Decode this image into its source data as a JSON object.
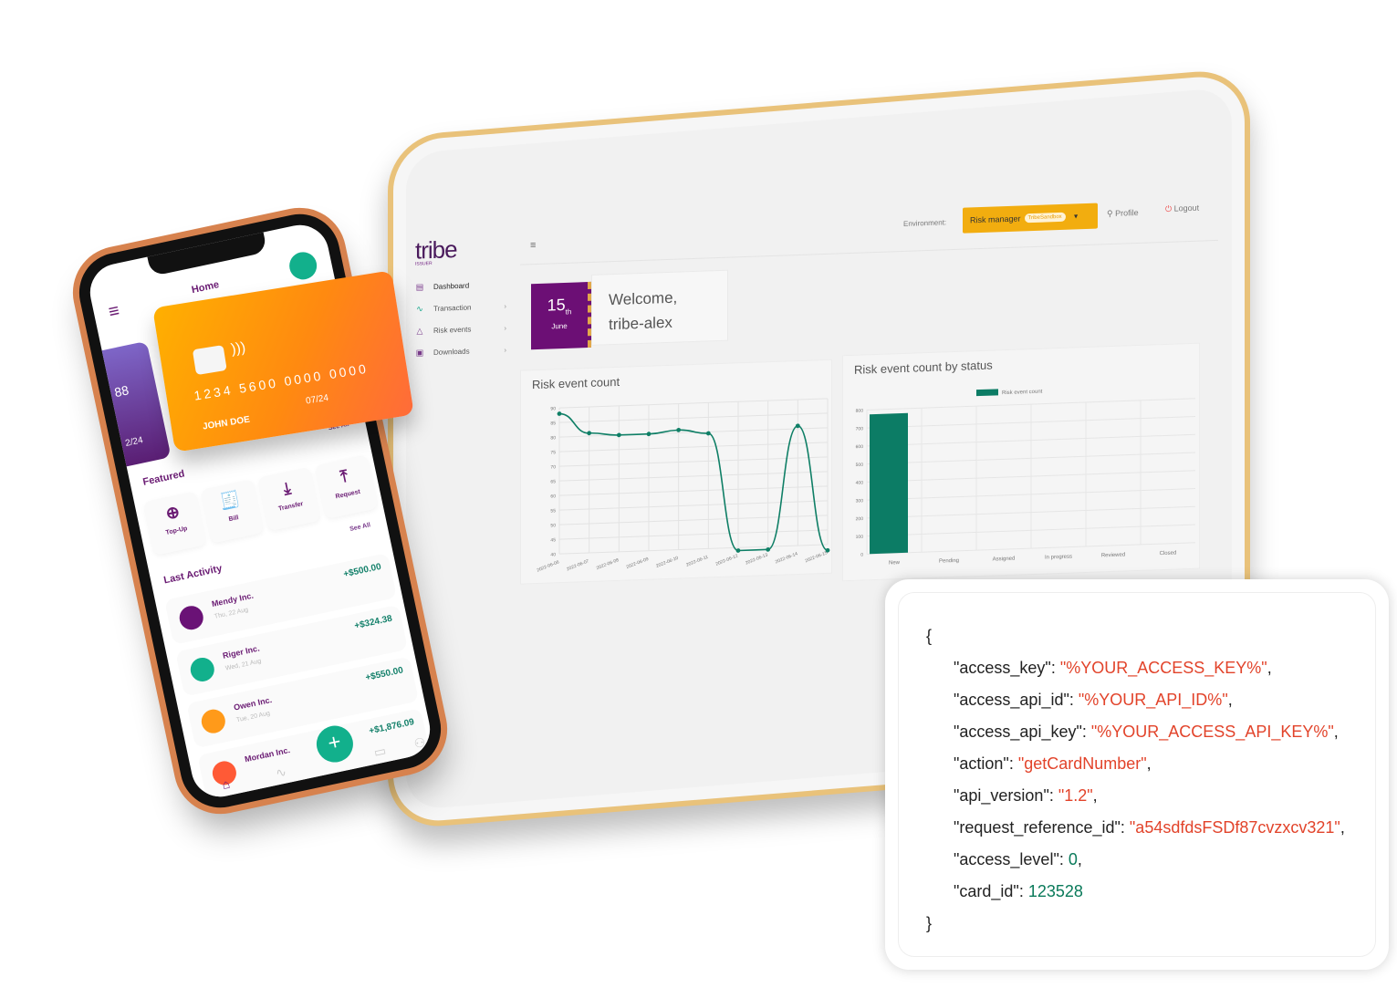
{
  "tablet": {
    "logo": "tribe",
    "logo_sub": "ISSUER",
    "sidebar": [
      {
        "label": "Dashboard",
        "icon": "calendar-icon",
        "active": true
      },
      {
        "label": "Transaction",
        "icon": "pulse-icon"
      },
      {
        "label": "Risk events",
        "icon": "warning-icon"
      },
      {
        "label": "Downloads",
        "icon": "save-icon"
      }
    ],
    "header": {
      "environment_label": "Environment:",
      "role": "Risk manager",
      "env_badge": "TribeSandbox",
      "profile": "Profile",
      "logout": "Logout"
    },
    "date": {
      "day": "15",
      "suffix": "th",
      "month": "June"
    },
    "welcome": {
      "line1": "Welcome,",
      "line2": "tribe-alex"
    }
  },
  "chart_data": [
    {
      "type": "line",
      "title": "Risk event count",
      "categories": [
        "2022-06-06",
        "2022-06-07",
        "2022-06-08",
        "2022-06-09",
        "2022-06-10",
        "2022-06-11",
        "2022-06-12",
        "2022-06-13",
        "2022-06-14",
        "2022-06-15"
      ],
      "values": [
        88,
        81,
        80,
        80,
        81,
        79.5,
        39,
        39,
        81,
        38
      ],
      "ylim": [
        40,
        90
      ],
      "yticks": [
        40,
        45,
        50,
        55,
        60,
        65,
        70,
        75,
        80,
        85,
        90
      ],
      "grid": true,
      "color": "#0f7f66"
    },
    {
      "type": "bar",
      "title": "Risk event count by status",
      "categories": [
        "New",
        "Pending",
        "Assigned",
        "In progress",
        "Reviewed",
        "Closed"
      ],
      "series": [
        {
          "name": "Risk event count",
          "values": [
            775,
            0,
            0,
            0,
            0,
            0
          ]
        }
      ],
      "ylim": [
        0,
        800
      ],
      "yticks": [
        0,
        100,
        200,
        300,
        400,
        500,
        600,
        700,
        800
      ],
      "legend": "top",
      "grid": true,
      "color": "#0c7c65"
    }
  ],
  "phone": {
    "title": "Home",
    "card_number": "1234 5600 0000 0000",
    "card_holder": "JOHN DOE",
    "card_expiry": "07/24",
    "back_card_digits": "88",
    "back_card_expiry": "2/24",
    "featured_label": "Featured",
    "see_all": "See All",
    "featured": [
      {
        "label": "Top-Up",
        "icon": "plus-circle-icon"
      },
      {
        "label": "Bill",
        "icon": "bill-icon"
      },
      {
        "label": "Transfer",
        "icon": "download-icon"
      },
      {
        "label": "Request",
        "icon": "upload-icon"
      }
    ],
    "last_activity_label": "Last Activity",
    "activity": [
      {
        "name": "Mendy Inc.",
        "date": "Thu, 22 Aug",
        "amount": "+$500.00",
        "color": "#6a1276"
      },
      {
        "name": "Riger Inc.",
        "date": "Wed, 21 Aug",
        "amount": "+$324.38",
        "color": "#12b08c"
      },
      {
        "name": "Owen Inc.",
        "date": "Tue, 20 Aug",
        "amount": "+$550.00",
        "color": "#ff9a1a"
      },
      {
        "name": "Mordan Inc.",
        "date": "",
        "amount": "+$1,876.09",
        "color": "#ff5a36"
      }
    ]
  },
  "json_sample": {
    "open": "{",
    "close": "}",
    "lines": [
      {
        "key": "\"access_key\"",
        "value": "\"%YOUR_ACCESS_KEY%\"",
        "kind": "str"
      },
      {
        "key": "\"access_api_id\"",
        "value": "\"%YOUR_API_ID%\"",
        "kind": "str"
      },
      {
        "key": "\"access_api_key\"",
        "value": "\"%YOUR_ACCESS_API_KEY%\"",
        "kind": "str"
      },
      {
        "key": "\"action\"",
        "value": "\"getCardNumber\"",
        "kind": "str"
      },
      {
        "key": "\"api_version\"",
        "value": "\"1.2\"",
        "kind": "str"
      },
      {
        "key": "\"request_reference_id\"",
        "value": "\"a54sdfdsFSDf87cvzxcv321\"",
        "kind": "str"
      },
      {
        "key": "\"access_level\"",
        "value": "0",
        "kind": "num"
      },
      {
        "key": "\"card_id\"",
        "value": "123528",
        "kind": "num",
        "last": true
      }
    ]
  }
}
